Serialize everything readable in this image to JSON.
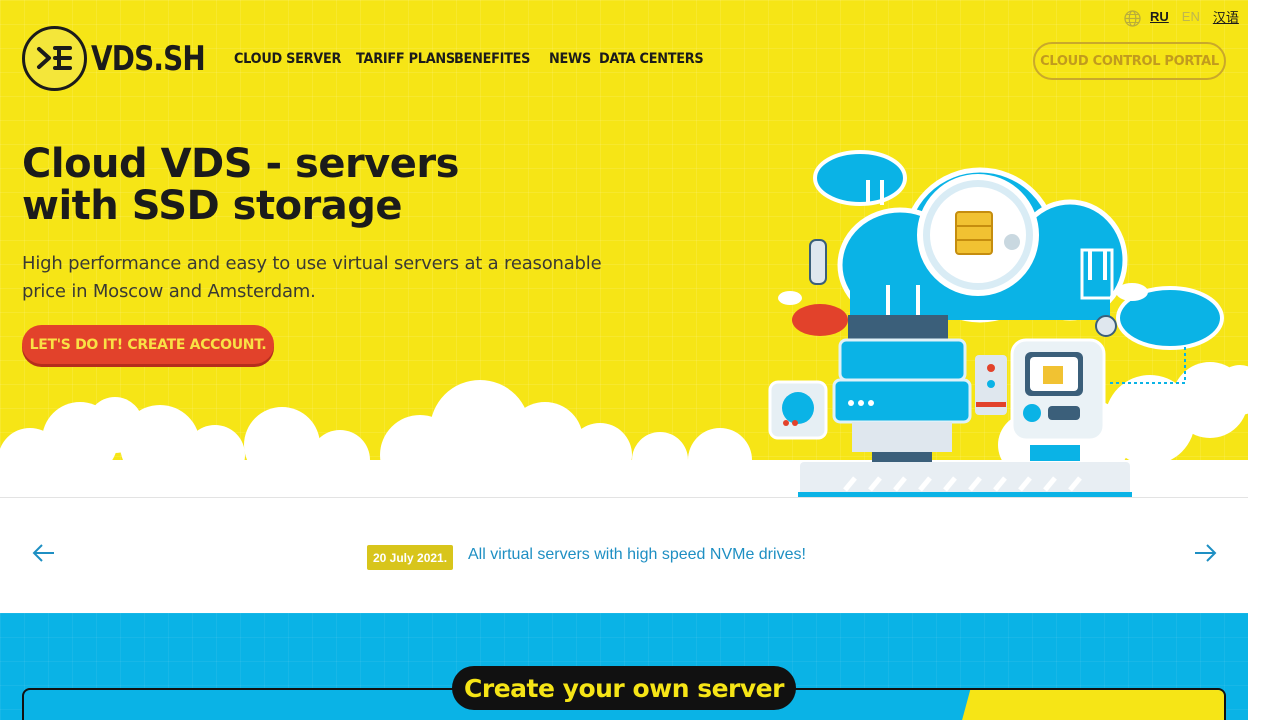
{
  "brand": {
    "name": "VDS.SH"
  },
  "nav": {
    "items": [
      {
        "label": "CLOUD SERVER"
      },
      {
        "label": "TARIFF PLANS"
      },
      {
        "label": "BENEFITES"
      },
      {
        "label": "NEWS"
      },
      {
        "label": "DATA CENTERS"
      }
    ]
  },
  "lang": {
    "icon": "globe-icon",
    "ru": "RU",
    "en": "EN",
    "cn": "汉语",
    "active": "RU"
  },
  "header": {
    "portal_label": "CLOUD CONTROL PORTAL"
  },
  "hero": {
    "title_line1": "Cloud VDS - servers",
    "title_line2": "with SSD storage",
    "subtitle": "High performance and easy to use virtual servers at a reasonable price in Moscow and Amsterdam.",
    "cta_label": "LET'S DO IT! CREATE ACCOUNT."
  },
  "news": {
    "date": "20 July 2021.",
    "text": "All virtual servers with high speed NVMe drives!",
    "prev_icon": "arrow-left-icon",
    "next_icon": "arrow-right-icon"
  },
  "configurator": {
    "title": "Create your own server"
  },
  "colors": {
    "hero_bg": "#f6e516",
    "accent_red": "#e2422b",
    "link_blue": "#1e8fc3",
    "section_blue": "#0ab3e6"
  }
}
